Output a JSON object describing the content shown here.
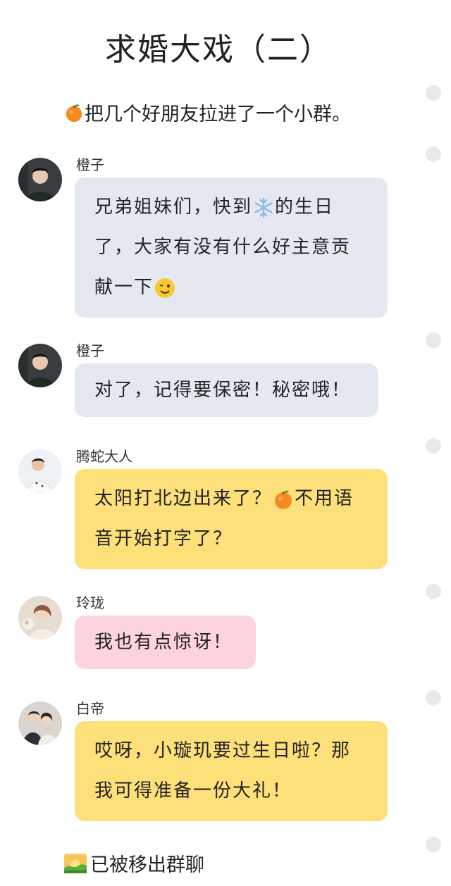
{
  "title": "求婚大戏（二）",
  "intro_note": "把几个好朋友拉进了一个小群。",
  "messages": [
    {
      "sender": "橙子",
      "text_part1": "兄弟姐妹们，快到",
      "text_part2": "的生日了，大家有没有什么好主意贡献一下",
      "avatar": "young-man-portrait"
    },
    {
      "sender": "橙子",
      "text": "对了，记得要保密！秘密哦！",
      "avatar": "young-man-portrait"
    },
    {
      "sender": "腾蛇大人",
      "text_part1": "太阳打北边出来了？",
      "text_part2": "不用语音开始打字了？",
      "avatar": "man-white-shirt"
    },
    {
      "sender": "玲珑",
      "text": "我也有点惊讶！",
      "avatar": "woman-with-flowers"
    },
    {
      "sender": "白帝",
      "text": "哎呀，小璇玑要过生日啦？那我可得准备一份大礼！",
      "avatar": "couple-photo"
    }
  ],
  "footer_note": "已被移出群聊",
  "icons": {
    "orange": "orange-emoji",
    "snowflake": "snowflake-emoji",
    "wink": "winking-face-emoji",
    "sunrise": "sunrise-emoji"
  },
  "colors": {
    "gray_bubble": "#e4e9f1",
    "yellow_bubble": "#fde07a",
    "pink_bubble": "#fdd4dd"
  }
}
